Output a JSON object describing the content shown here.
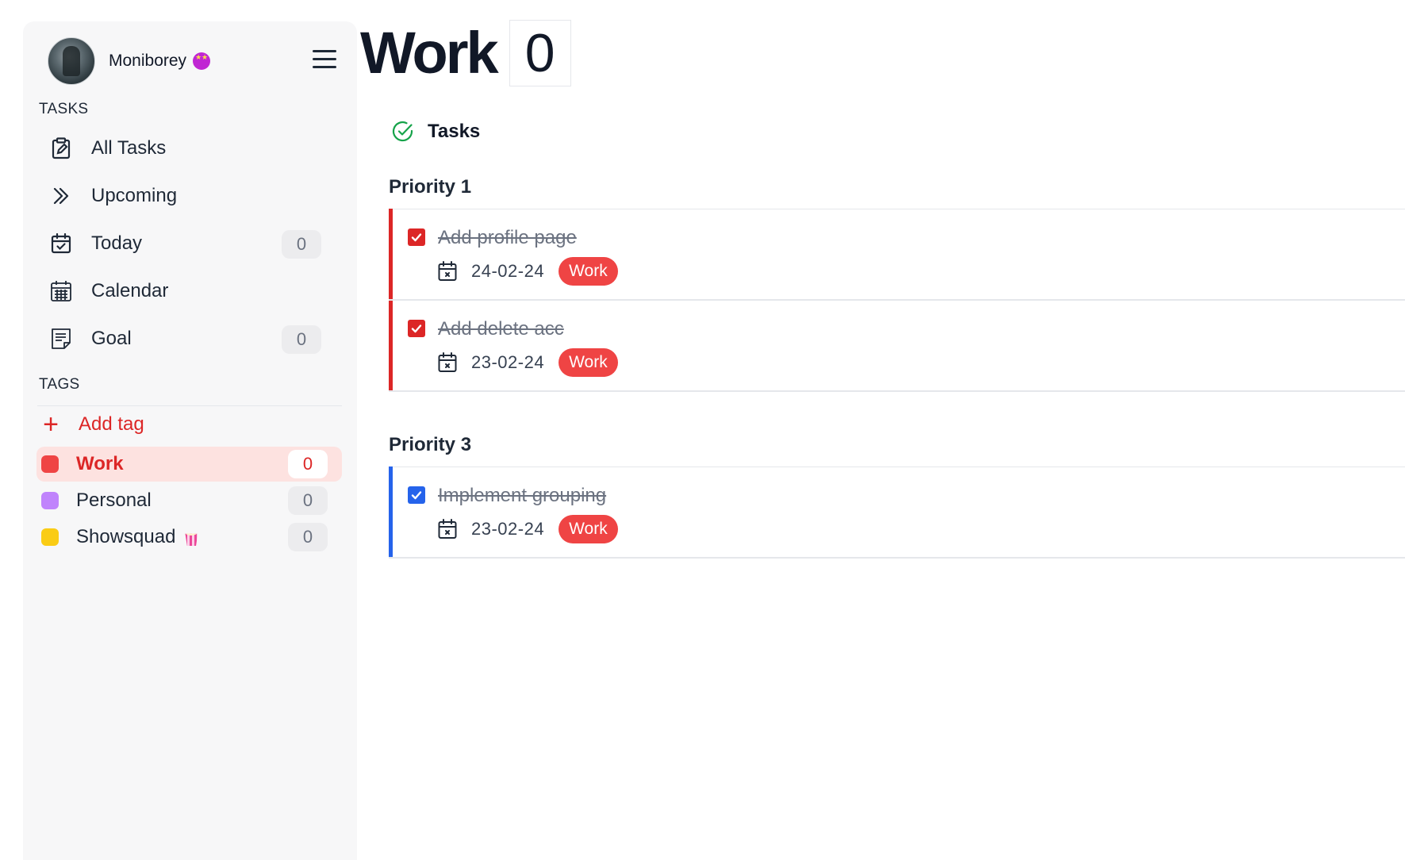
{
  "profile": {
    "username": "Moniborey"
  },
  "sidebar": {
    "tasks_section_label": "TASKS",
    "nav_items": [
      {
        "label": "All Tasks",
        "icon": "clipboard-edit-icon",
        "count": null
      },
      {
        "label": "Upcoming",
        "icon": "double-chevron-right-icon",
        "count": null
      },
      {
        "label": "Today",
        "icon": "calendar-check-icon",
        "count": "0"
      },
      {
        "label": "Calendar",
        "icon": "calendar-grid-icon",
        "count": null
      },
      {
        "label": "Goal",
        "icon": "note-icon",
        "count": "0"
      }
    ],
    "tags_section_label": "TAGS",
    "add_tag_label": "Add tag",
    "tags": [
      {
        "label": "Work",
        "color": "#ef4444",
        "count": "0",
        "active": true
      },
      {
        "label": "Personal",
        "color": "#c084fc",
        "count": "0",
        "active": false
      },
      {
        "label": "Showsquad",
        "color": "#facc15",
        "count": "0",
        "active": false
      }
    ]
  },
  "main": {
    "title": "Work",
    "title_count": "0",
    "section_title": "Tasks",
    "groups": [
      {
        "title": "Priority 1",
        "color": "#dc2626",
        "tasks": [
          {
            "name": "Add profile page",
            "date": "24-02-24",
            "tag": "Work",
            "done": true
          },
          {
            "name": "Add delete acc",
            "date": "23-02-24",
            "tag": "Work",
            "done": true
          }
        ]
      },
      {
        "title": "Priority 3",
        "color": "#2563eb",
        "tasks": [
          {
            "name": "Implement grouping",
            "date": "23-02-24",
            "tag": "Work",
            "done": true
          }
        ]
      }
    ]
  }
}
